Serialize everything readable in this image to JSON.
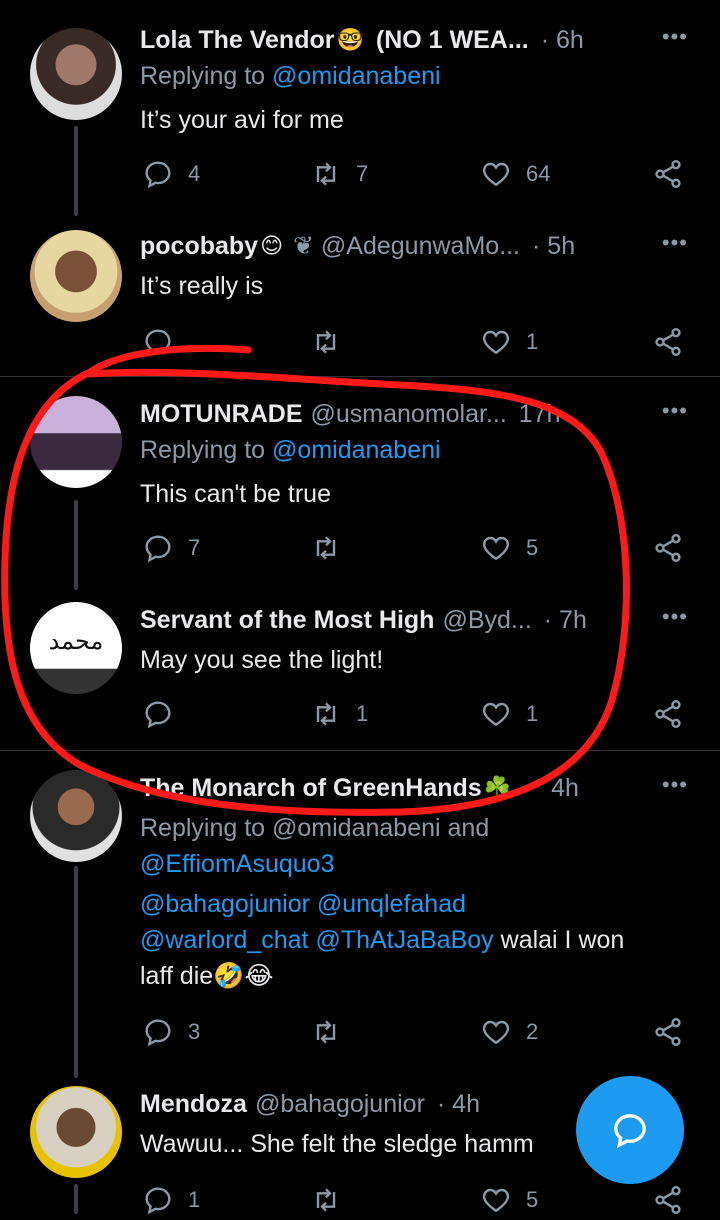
{
  "tweets": [
    {
      "name": "Lola The Vendor",
      "name_emoji": "🤓",
      "name_suffix": "(NO 1 WEA...",
      "handle": "",
      "time": "· 6h",
      "replying_prefix": "Replying to",
      "replying_to": "@omidanabeni",
      "text": "It’s your avi for me",
      "replies": "4",
      "retweets": "7",
      "likes": "64",
      "avatar_color": "#8a6a5a"
    },
    {
      "name": "pocobaby",
      "name_emoji": "😊",
      "handle": "❦ @AdegunwaMo...",
      "time": "· 5h",
      "text": "It’s really is",
      "replies": "",
      "retweets": "",
      "likes": "1",
      "avatar_color": "#c9a36f"
    },
    {
      "name": "MOTUNRADE",
      "handle": "@usmanomolar...",
      "time": "17h",
      "replying_prefix": "Replying to",
      "replying_to": "@omidanabeni",
      "text": "This can't be true",
      "replies": "7",
      "retweets": "",
      "likes": "5",
      "avatar_color": "#7d6aa0"
    },
    {
      "name": "Servant of the Most High",
      "handle": "@Byd...",
      "time": "· 7h",
      "text": "May you see the light!",
      "replies": "",
      "retweets": "1",
      "likes": "1",
      "avatar_glyph": "محمد",
      "avatar_color": "#ffffff"
    },
    {
      "name": "The Monarch of GreenHands",
      "name_emoji": "☘️",
      "handle": "",
      "time": "4h",
      "replying_line": "Replying to @omidanabeni and",
      "mention_line2": "@EffiomAsuquo3",
      "mentions_a": "@bahagojunior @unqlefahad",
      "mentions_b": "@warlord_chat @ThAtJaBaBoy",
      "text_tail": "walai I won",
      "text_line2": "laff die",
      "text_emoji": "🤣😂",
      "replies": "3",
      "retweets": "",
      "likes": "2",
      "avatar_color": "#6b5040"
    },
    {
      "name": "Mendoza",
      "handle": "@bahagojunior",
      "time": "· 4h",
      "text": "Wawuu... She felt the sledge hamm",
      "replies": "1",
      "retweets": "",
      "likes": "5",
      "avatar_color": "#5a4a3a"
    }
  ],
  "fab": {
    "icon": "compose-reply-icon"
  },
  "colors": {
    "accent": "#1d9bf0",
    "muted": "#8b98a5",
    "annotation": "#ff1a1a"
  }
}
